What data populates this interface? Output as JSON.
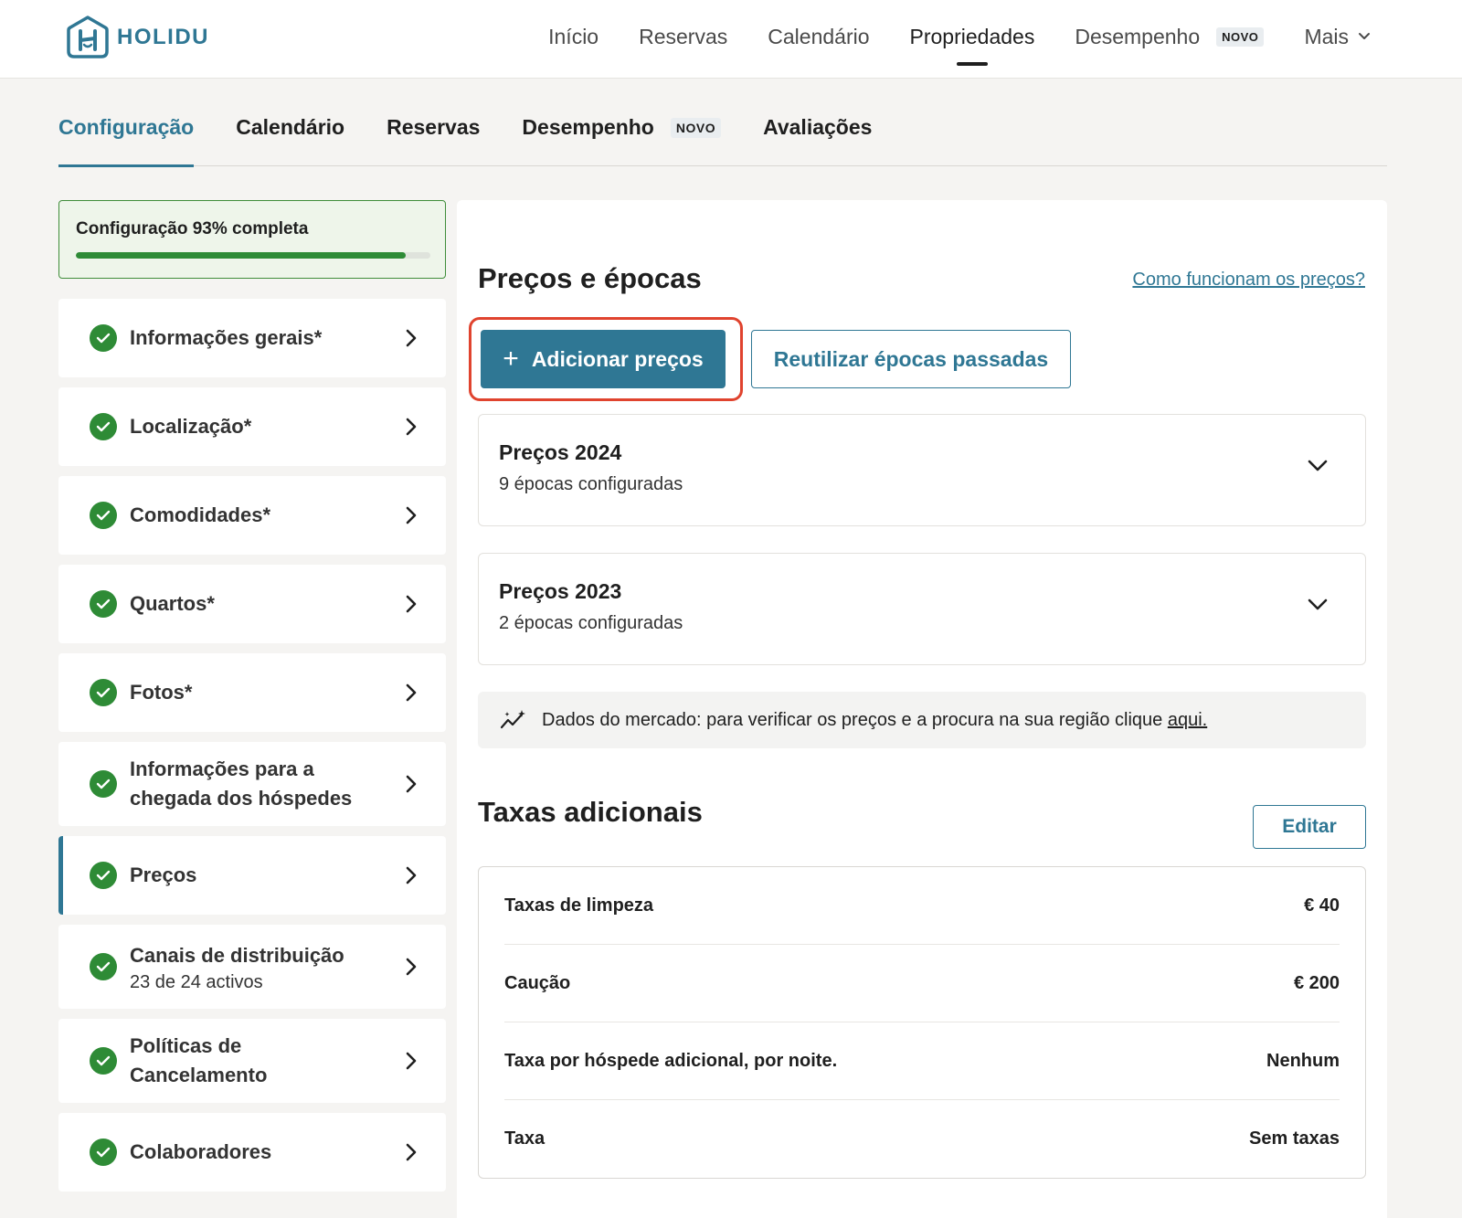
{
  "brand": {
    "name": "HOLIDU",
    "color": "#2f7794"
  },
  "topnav": {
    "items": [
      {
        "label": "Início"
      },
      {
        "label": "Reservas"
      },
      {
        "label": "Calendário"
      },
      {
        "label": "Propriedades",
        "active": true
      },
      {
        "label": "Desempenho",
        "badge": "NOVO"
      },
      {
        "label": "Mais"
      }
    ]
  },
  "subtabs": [
    {
      "label": "Configuração",
      "active": true
    },
    {
      "label": "Calendário"
    },
    {
      "label": "Reservas"
    },
    {
      "label": "Desempenho",
      "badge": "NOVO"
    },
    {
      "label": "Avaliações"
    }
  ],
  "progress": {
    "label": "Configuração 93% completa",
    "percent": 93
  },
  "sidebar": {
    "items": [
      {
        "label": "Informações gerais*"
      },
      {
        "label": "Localização*"
      },
      {
        "label": "Comodidades*"
      },
      {
        "label": "Quartos*"
      },
      {
        "label": "Fotos*"
      },
      {
        "label": "Informações para a chegada dos hóspedes"
      },
      {
        "label": "Preços",
        "active": true
      },
      {
        "label": "Canais de distribuição",
        "sub": "23 de 24 activos"
      },
      {
        "label": "Políticas de Cancelamento"
      },
      {
        "label": "Colaboradores"
      }
    ]
  },
  "pricing": {
    "title": "Preços e épocas",
    "help_link": "Como funcionam os preços?",
    "add_button": "Adicionar preços",
    "reuse_button": "Reutilizar épocas passadas",
    "groups": [
      {
        "title": "Preços 2024",
        "sub": "9 épocas configuradas"
      },
      {
        "title": "Preços 2023",
        "sub": "2 épocas configuradas"
      }
    ],
    "market_text": "Dados do mercado: para verificar os preços e a procura na sua região clique ",
    "market_link": "aqui."
  },
  "fees": {
    "title": "Taxas adicionais",
    "edit_button": "Editar",
    "rows": [
      {
        "label": "Taxas de limpeza",
        "value": "€ 40"
      },
      {
        "label": "Caução",
        "value": "€ 200"
      },
      {
        "label": "Taxa por hóspede adicional, por noite.",
        "value": "Nenhum"
      },
      {
        "label": "Taxa",
        "value": "Sem taxas"
      }
    ]
  },
  "colors": {
    "accent": "#2f7794",
    "success": "#2e8b36",
    "highlight": "#e0432e"
  }
}
